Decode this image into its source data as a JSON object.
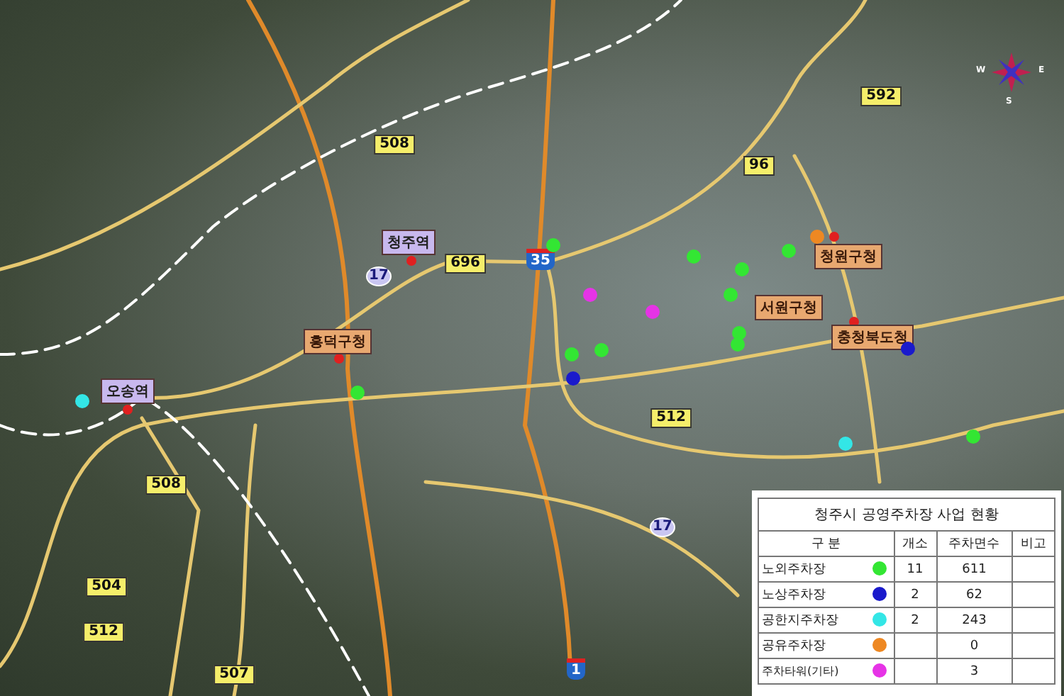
{
  "map": {
    "compass": {
      "letters": [
        "W",
        "E",
        "S"
      ]
    },
    "road_shields": [
      {
        "kind": "local",
        "number": "508"
      },
      {
        "kind": "local",
        "number": "592"
      },
      {
        "kind": "local",
        "number": "96"
      },
      {
        "kind": "local",
        "number": "696"
      },
      {
        "kind": "expressway",
        "number": "35"
      },
      {
        "kind": "national",
        "number": "17"
      },
      {
        "kind": "local",
        "number": "508"
      },
      {
        "kind": "local",
        "number": "512"
      },
      {
        "kind": "national",
        "number": "17"
      },
      {
        "kind": "local",
        "number": "504"
      },
      {
        "kind": "local",
        "number": "512"
      },
      {
        "kind": "local",
        "number": "507"
      },
      {
        "kind": "expressway",
        "number": "1"
      }
    ],
    "place_labels": [
      {
        "kind": "station",
        "text": "청주역"
      },
      {
        "kind": "office",
        "text": "흥덕구청"
      },
      {
        "kind": "station",
        "text": "오송역"
      },
      {
        "kind": "office",
        "text": "청원구청"
      },
      {
        "kind": "office",
        "text": "서원구청"
      },
      {
        "kind": "office",
        "text": "충청북도청"
      }
    ],
    "parking_sites": [
      {
        "color": "#33e633"
      },
      {
        "color": "#33e633"
      },
      {
        "color": "#33e633"
      },
      {
        "color": "#33e633"
      },
      {
        "color": "#33e633"
      },
      {
        "color": "#33e633"
      },
      {
        "color": "#33e633"
      },
      {
        "color": "#33e633"
      },
      {
        "color": "#33e633"
      },
      {
        "color": "#33e633"
      },
      {
        "color": "#33e633"
      },
      {
        "color": "#1a1acc"
      },
      {
        "color": "#1a1acc"
      },
      {
        "color": "#33e6e6"
      },
      {
        "color": "#33e6e6"
      },
      {
        "color": "#ee8822"
      },
      {
        "color": "#e633e6"
      },
      {
        "color": "#e633e6"
      }
    ]
  },
  "table": {
    "title": "청주시 공영주차장 사업 현황",
    "columns": [
      "구 분",
      "개소",
      "주차면수",
      "비고"
    ],
    "rows": [
      {
        "name": "노외주차장",
        "color": "#33e633",
        "count": "11",
        "spaces": "611"
      },
      {
        "name": "노상주차장",
        "color": "#1a1acc",
        "count": "2",
        "spaces": "62"
      },
      {
        "name": "공한지주차장",
        "color": "#33e6e6",
        "count": "2",
        "spaces": "243"
      },
      {
        "name": "공유주차장",
        "color": "#ee8822",
        "spaces": "0"
      },
      {
        "name": "주차타워(기타)",
        "color": "#e633e6",
        "spaces": "3"
      }
    ]
  }
}
